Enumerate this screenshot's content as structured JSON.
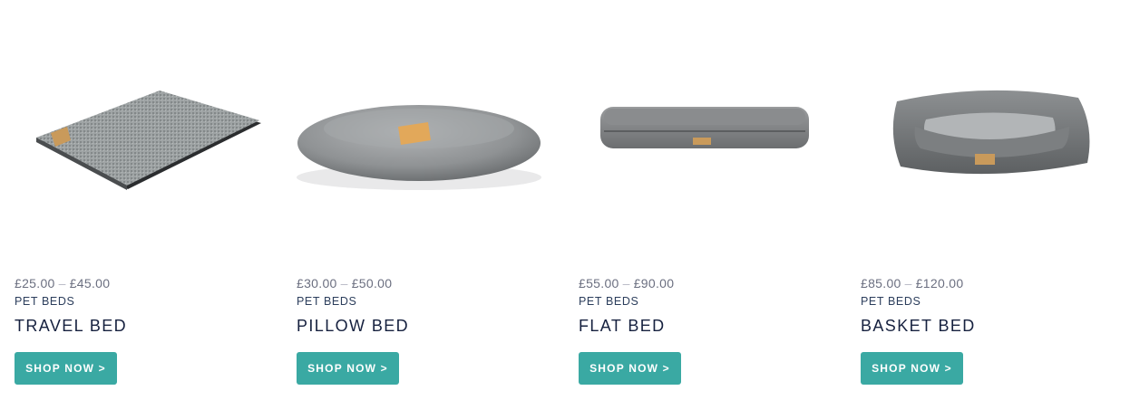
{
  "products": [
    {
      "price_from": "£25.00",
      "price_separator": "–",
      "price_to": "£45.00",
      "category": "PET BEDS",
      "title": "TRAVEL BED",
      "button_label": "SHOP NOW >"
    },
    {
      "price_from": "£30.00",
      "price_separator": "–",
      "price_to": "£50.00",
      "category": "PET BEDS",
      "title": "PILLOW BED",
      "button_label": "SHOP NOW >"
    },
    {
      "price_from": "£55.00",
      "price_separator": "–",
      "price_to": "£90.00",
      "category": "PET BEDS",
      "title": "FLAT BED",
      "button_label": "SHOP NOW >"
    },
    {
      "price_from": "£85.00",
      "price_separator": "–",
      "price_to": "£120.00",
      "category": "PET BEDS",
      "title": "BASKET BED",
      "button_label": "SHOP NOW >"
    }
  ],
  "colors": {
    "button_bg": "#3aa9a3",
    "title_text": "#16213f",
    "price_text": "#6b6f80",
    "fabric_grey": "#8a8d90",
    "label_tan": "#d4a05a"
  }
}
